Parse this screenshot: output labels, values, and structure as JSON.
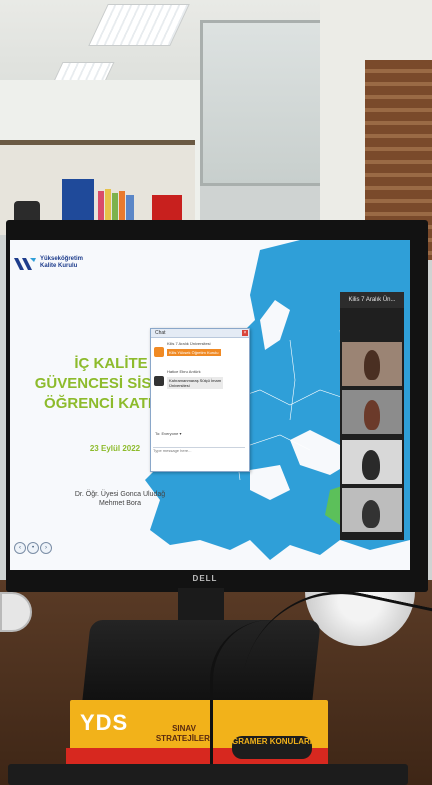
{
  "slide": {
    "logo_line1": "Yükseköğretim",
    "logo_line2": "Kalite Kurulu",
    "title_line1": "İÇ KALİTE",
    "title_line2": "GÜVENCESİ SİSTEMİ",
    "title_line3": "ÖĞRENCİ KATILIM",
    "date": "23 Eylül 2022",
    "author_line1": "Dr. Öğr. Üyesi Gonca Uludağ",
    "author_line2": "Mehmet Bora",
    "nav_prev": "‹",
    "nav_play": "•",
    "nav_next": "›"
  },
  "chat": {
    "title": "Chat",
    "org1": "Kilis 7 Aralık Üniversitesi",
    "org2": "Hatice Ebru Arıtürk",
    "msg1": "Kilis Yüksek Öğretim Kurulu",
    "org3": "Kahramanmaraş Sütçü İmam",
    "msg2": "Üniversitesi",
    "recipient": "Everyone",
    "input_placeholder": "Type message here..."
  },
  "zoom": {
    "header": "Kilis 7 Aralık Ün..."
  },
  "monitor": {
    "brand": "DELL"
  },
  "books": {
    "yds": "YDS",
    "sinav": "SINAV STRATEJİLERİ",
    "gramer": "GRAMER KONULARI"
  },
  "colors": {
    "map_blue": "#2f9fd8",
    "title_green": "#8dbb2c",
    "logo_navy": "#1e3d8c"
  }
}
